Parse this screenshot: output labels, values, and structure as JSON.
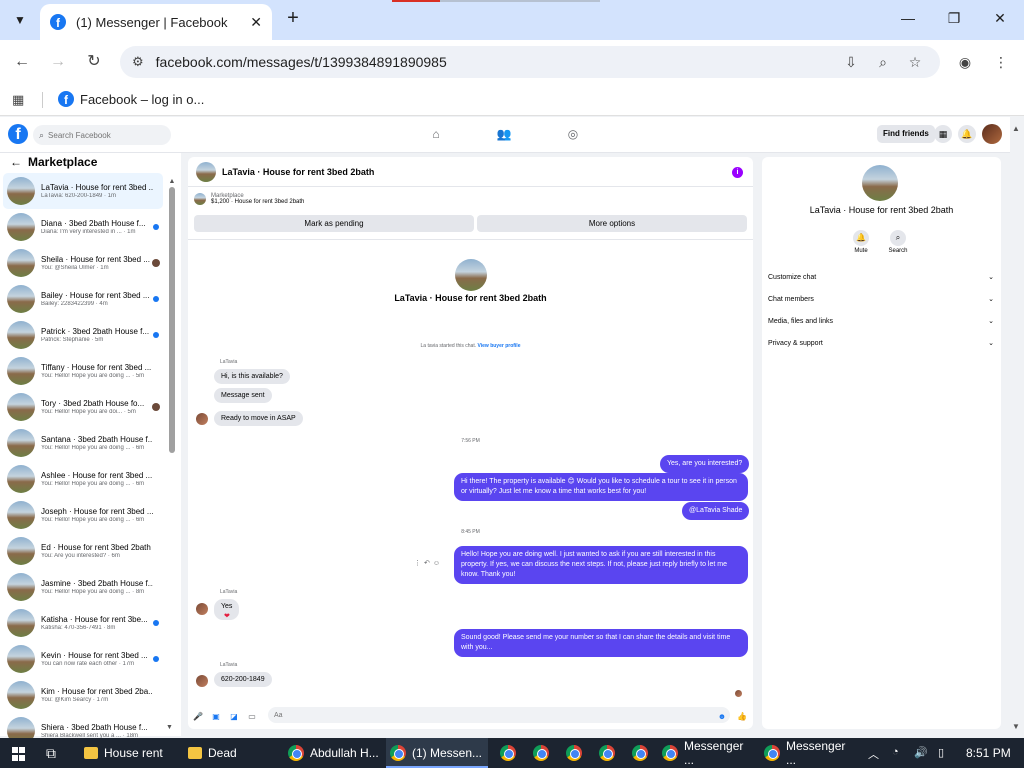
{
  "browser": {
    "tab_title": "(1) Messenger | Facebook",
    "url": "facebook.com/messages/t/1399384891890985",
    "bookmark": "Facebook – log in o..."
  },
  "fb": {
    "search_placeholder": "Search Facebook",
    "find_friends": "Find friends"
  },
  "left": {
    "title": "Marketplace",
    "conversations": [
      {
        "name": "LaTavia · House for rent 3bed ...",
        "preview": "LaTavia: 620-200-1849 · 1m"
      },
      {
        "name": "Diana · 3bed 2bath House f...",
        "preview": "Diana: I'm very interested in ... · 1m"
      },
      {
        "name": "Sheila · House for rent 3bed ...",
        "preview": "You: @Sheila Ulmer · 1m"
      },
      {
        "name": "Bailey · House for rent 3bed ...",
        "preview": "Bailey: 2283422399 · 4m"
      },
      {
        "name": "Patrick · 3bed 2bath House f...",
        "preview": "Patrick: Stephanie · 5m"
      },
      {
        "name": "Tiffany · House for rent 3bed ...",
        "preview": "You: Hello! Hope you are doing ... · 5m"
      },
      {
        "name": "Tory · 3bed 2bath House fo...",
        "preview": "You: Hello! Hope you are doi... · 5m"
      },
      {
        "name": "Santana · 3bed 2bath House f...",
        "preview": "You: Hello! Hope you are doing ... · 6m"
      },
      {
        "name": "Ashlee · House for rent 3bed ...",
        "preview": "You: Hello! Hope you are doing ... · 6m"
      },
      {
        "name": "Joseph · House for rent 3bed ...",
        "preview": "You: Hello! Hope you are doing ... · 6m"
      },
      {
        "name": "Ed · House for rent 3bed 2bath",
        "preview": "You: Are you interested? · 6m"
      },
      {
        "name": "Jasmine · 3bed 2bath House f...",
        "preview": "You: Hello! Hope you are doing ... · 8m"
      },
      {
        "name": "Katisha · House for rent 3be...",
        "preview": "Katisha: 470-356-7491 · 8m"
      },
      {
        "name": "Kevin · House for rent 3bed ...",
        "preview": "You can now rate each other · 17m"
      },
      {
        "name": "Kim · House for rent 3bed 2ba...",
        "preview": "You: @Kim Searcy · 17m"
      },
      {
        "name": "Shiera · 3bed 2bath House f...",
        "preview": "Shiera Blackwell sent you a ... · 18m"
      }
    ]
  },
  "chat": {
    "title": "LaTavia · House for rent 3bed 2bath",
    "marketplace_label": "Marketplace",
    "listing": "$1,200 · House for rent 3bed 2bath",
    "mark_pending": "Mark as pending",
    "more_options": "More options",
    "intro_name": "LaTavia · House for rent 3bed 2bath",
    "started_text": "La tavia started this chat.",
    "view_buyer": "View buyer profile",
    "sender_name": "LaTavia",
    "msg1": "Hi, is this available?",
    "msg2": "Message sent",
    "msg3": "Ready to move in ASAP",
    "time1": "7:56 PM",
    "out1": "Yes, are you interested?",
    "out2": "Hi there! The property is available 😊 Would you like to schedule a tour to see it in person or virtually? Just let me know a time that works best for you!",
    "out3": "@LaTavia Shade",
    "time2": "8:45 PM",
    "out4": "Hello! Hope you are doing well. I just wanted to ask if you are still interested in this property. If yes, we can discuss the next steps. If not, please just reply briefly to let me know. Thank you!",
    "msg4": "Yes",
    "out5": "Sound good! Please send me your number so that I can share the details and visit time with you...",
    "msg5": "620-200-1849",
    "composer_placeholder": "Aa"
  },
  "right": {
    "name": "LaTavia · House for rent 3bed 2bath",
    "mute": "Mute",
    "search": "Search",
    "rows": [
      "Customize chat",
      "Chat members",
      "Media, files and links",
      "Privacy & support"
    ]
  },
  "taskbar": {
    "items": [
      "House rent",
      "Dead",
      "Abdullah H...",
      "(1) Messen...",
      "Messenger ...",
      "Messenger ..."
    ],
    "time": "8:51 PM"
  }
}
